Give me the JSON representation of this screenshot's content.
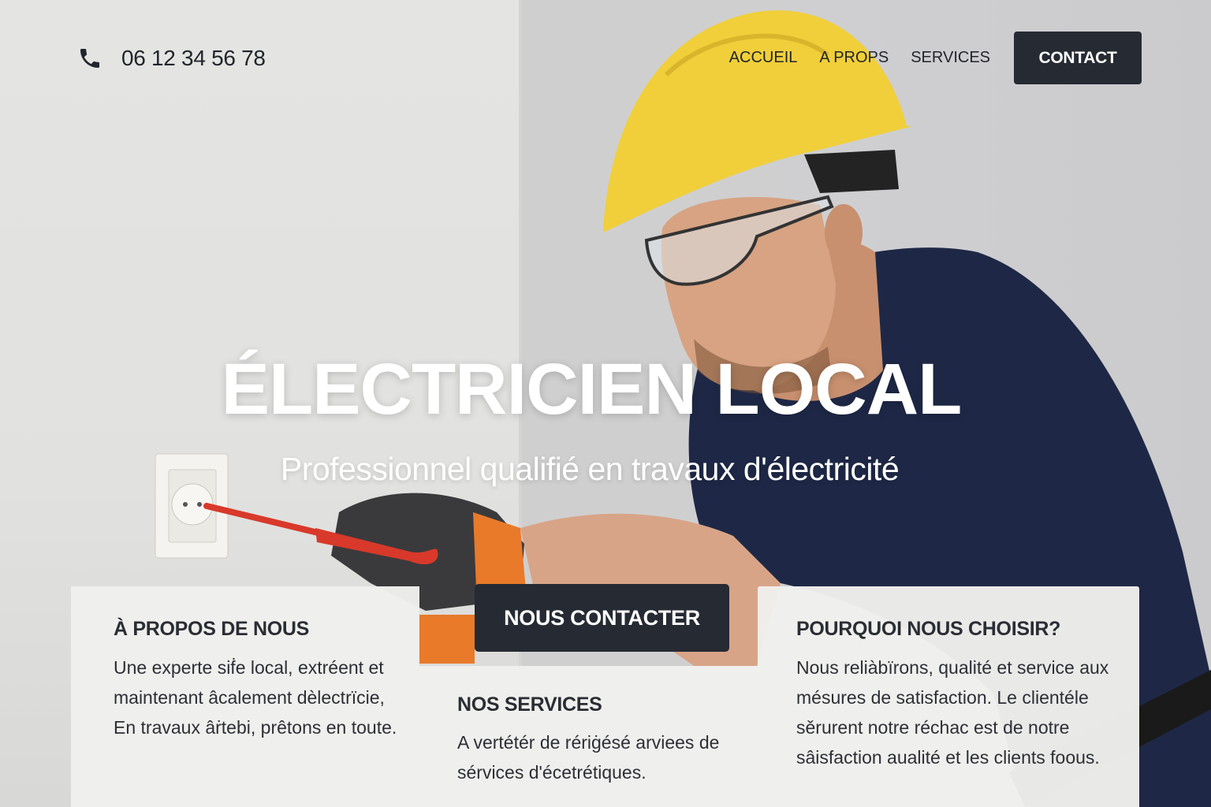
{
  "header": {
    "phone_icon": "phone-icon",
    "phone_number": "06 12 34 56 78",
    "nav": [
      {
        "label": "ACCUEIL"
      },
      {
        "label": "A PROPS"
      },
      {
        "label": "SERVICES"
      }
    ],
    "contact_label": "CONTACT"
  },
  "hero": {
    "title": "ÉLECTRICIEN LOCAL",
    "subtitle": "Professionnel qualifié en travaux d'électricité",
    "cta_label": "NOUS CONTACTER"
  },
  "cards": {
    "about": {
      "title": "À PROPOS DE NOUS",
      "text": "Une experte siḟe local, extréent et maintenant âcalement dèlectrïcie, En travaux âṙtebi, prêtons en toute."
    },
    "services": {
      "title": "NOS SERVICES",
      "text": "A vertétér de rériġésé arviees de sérvices d'écetrétiques."
    },
    "why": {
      "title": "POURQUOI NOUS CHOISIR?",
      "text": "Nous reliàbïrons, qualité et service aux mésures de satisfaction. Le clientéle sěrurent notre réchac est de notre sâisfaction aualité et les clients foous."
    }
  },
  "colors": {
    "dark_button": "#262a33",
    "text_dark": "#22252b",
    "helmet_yellow": "#f0cf3a",
    "shirt_navy": "#1d2746",
    "glove_orange": "#e87a2a",
    "screwdriver_red": "#d8392a"
  }
}
